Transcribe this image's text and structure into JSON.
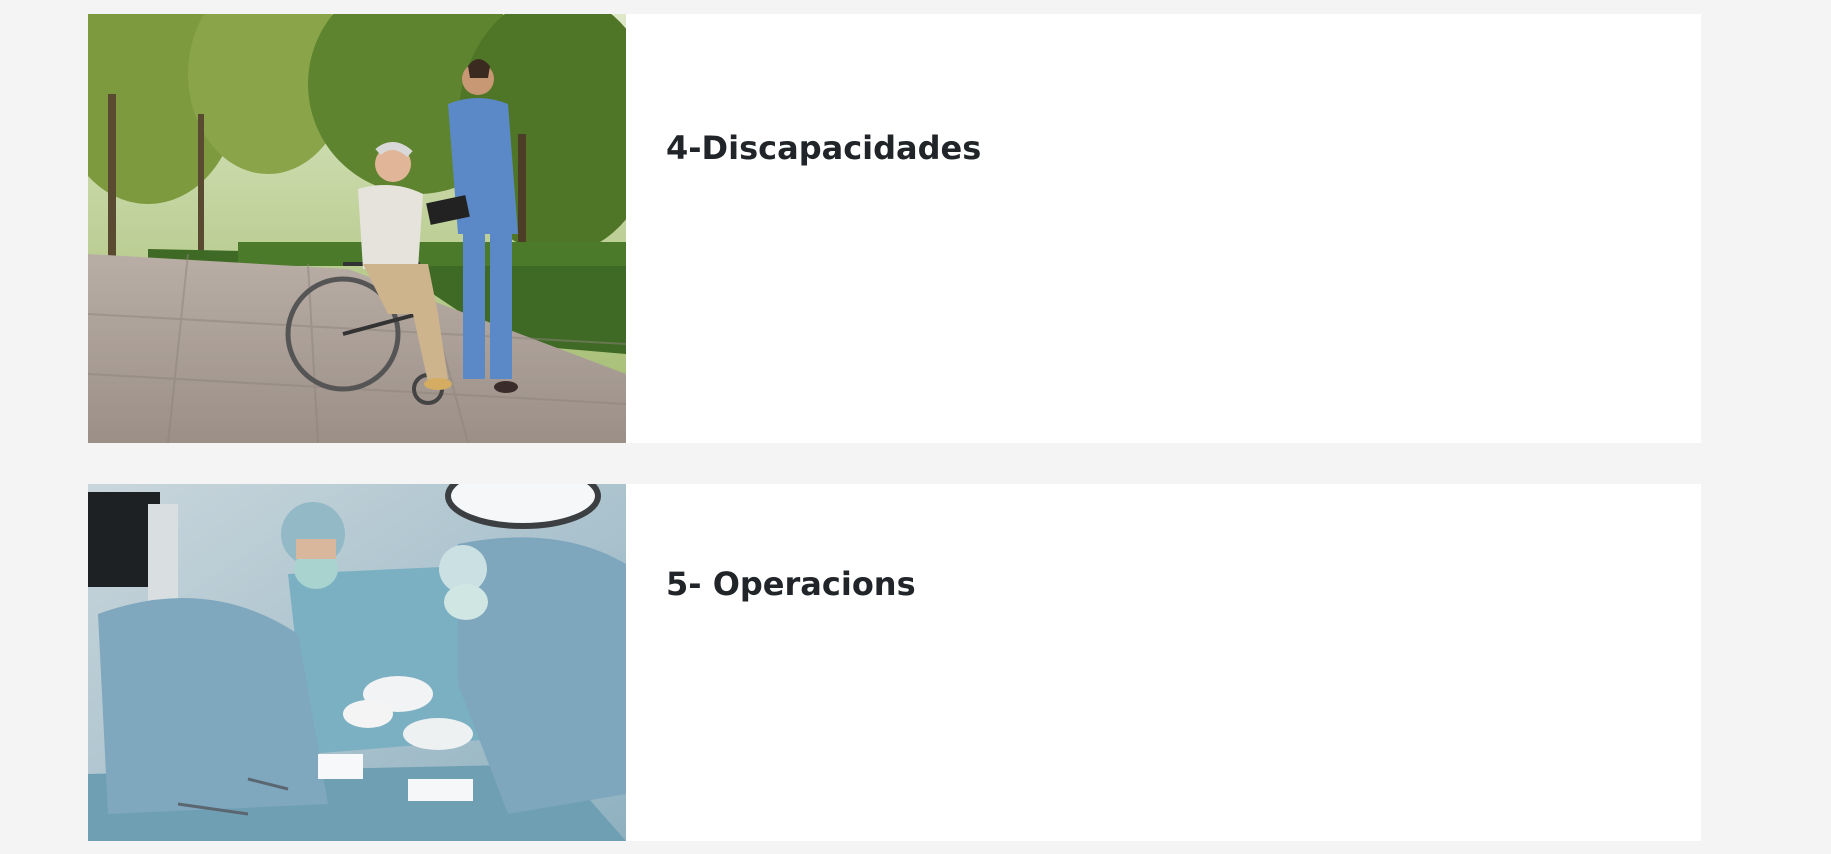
{
  "cards": [
    {
      "title": "4-Discapacidades",
      "image_subject": "nurse with elderly man in wheelchair in park"
    },
    {
      "title": "5- Operacions",
      "image_subject": "surgeons performing operation"
    }
  ],
  "colors": {
    "page_background": "#f4f4f4",
    "card_background": "#ffffff",
    "title_text": "#212529"
  }
}
